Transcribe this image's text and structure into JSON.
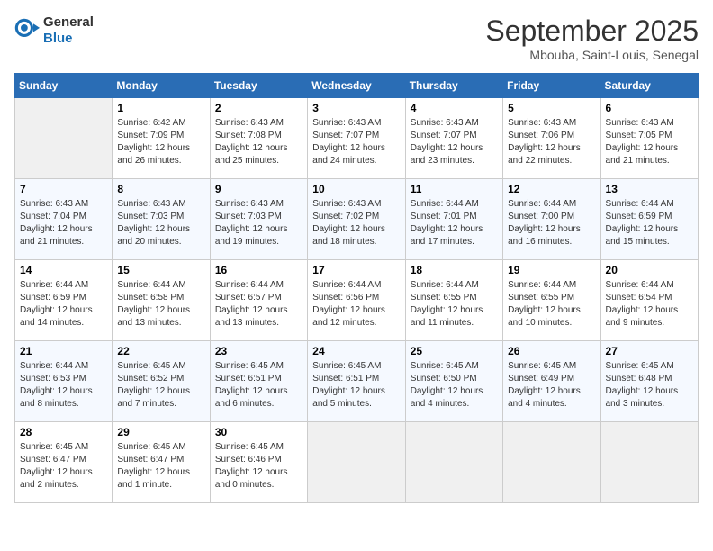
{
  "header": {
    "logo_line1": "General",
    "logo_line2": "Blue",
    "month": "September 2025",
    "location": "Mbouba, Saint-Louis, Senegal"
  },
  "days_of_week": [
    "Sunday",
    "Monday",
    "Tuesday",
    "Wednesday",
    "Thursday",
    "Friday",
    "Saturday"
  ],
  "weeks": [
    [
      {
        "num": "",
        "lines": []
      },
      {
        "num": "1",
        "lines": [
          "Sunrise: 6:42 AM",
          "Sunset: 7:09 PM",
          "Daylight: 12 hours",
          "and 26 minutes."
        ]
      },
      {
        "num": "2",
        "lines": [
          "Sunrise: 6:43 AM",
          "Sunset: 7:08 PM",
          "Daylight: 12 hours",
          "and 25 minutes."
        ]
      },
      {
        "num": "3",
        "lines": [
          "Sunrise: 6:43 AM",
          "Sunset: 7:07 PM",
          "Daylight: 12 hours",
          "and 24 minutes."
        ]
      },
      {
        "num": "4",
        "lines": [
          "Sunrise: 6:43 AM",
          "Sunset: 7:07 PM",
          "Daylight: 12 hours",
          "and 23 minutes."
        ]
      },
      {
        "num": "5",
        "lines": [
          "Sunrise: 6:43 AM",
          "Sunset: 7:06 PM",
          "Daylight: 12 hours",
          "and 22 minutes."
        ]
      },
      {
        "num": "6",
        "lines": [
          "Sunrise: 6:43 AM",
          "Sunset: 7:05 PM",
          "Daylight: 12 hours",
          "and 21 minutes."
        ]
      }
    ],
    [
      {
        "num": "7",
        "lines": [
          "Sunrise: 6:43 AM",
          "Sunset: 7:04 PM",
          "Daylight: 12 hours",
          "and 21 minutes."
        ]
      },
      {
        "num": "8",
        "lines": [
          "Sunrise: 6:43 AM",
          "Sunset: 7:03 PM",
          "Daylight: 12 hours",
          "and 20 minutes."
        ]
      },
      {
        "num": "9",
        "lines": [
          "Sunrise: 6:43 AM",
          "Sunset: 7:03 PM",
          "Daylight: 12 hours",
          "and 19 minutes."
        ]
      },
      {
        "num": "10",
        "lines": [
          "Sunrise: 6:43 AM",
          "Sunset: 7:02 PM",
          "Daylight: 12 hours",
          "and 18 minutes."
        ]
      },
      {
        "num": "11",
        "lines": [
          "Sunrise: 6:44 AM",
          "Sunset: 7:01 PM",
          "Daylight: 12 hours",
          "and 17 minutes."
        ]
      },
      {
        "num": "12",
        "lines": [
          "Sunrise: 6:44 AM",
          "Sunset: 7:00 PM",
          "Daylight: 12 hours",
          "and 16 minutes."
        ]
      },
      {
        "num": "13",
        "lines": [
          "Sunrise: 6:44 AM",
          "Sunset: 6:59 PM",
          "Daylight: 12 hours",
          "and 15 minutes."
        ]
      }
    ],
    [
      {
        "num": "14",
        "lines": [
          "Sunrise: 6:44 AM",
          "Sunset: 6:59 PM",
          "Daylight: 12 hours",
          "and 14 minutes."
        ]
      },
      {
        "num": "15",
        "lines": [
          "Sunrise: 6:44 AM",
          "Sunset: 6:58 PM",
          "Daylight: 12 hours",
          "and 13 minutes."
        ]
      },
      {
        "num": "16",
        "lines": [
          "Sunrise: 6:44 AM",
          "Sunset: 6:57 PM",
          "Daylight: 12 hours",
          "and 13 minutes."
        ]
      },
      {
        "num": "17",
        "lines": [
          "Sunrise: 6:44 AM",
          "Sunset: 6:56 PM",
          "Daylight: 12 hours",
          "and 12 minutes."
        ]
      },
      {
        "num": "18",
        "lines": [
          "Sunrise: 6:44 AM",
          "Sunset: 6:55 PM",
          "Daylight: 12 hours",
          "and 11 minutes."
        ]
      },
      {
        "num": "19",
        "lines": [
          "Sunrise: 6:44 AM",
          "Sunset: 6:55 PM",
          "Daylight: 12 hours",
          "and 10 minutes."
        ]
      },
      {
        "num": "20",
        "lines": [
          "Sunrise: 6:44 AM",
          "Sunset: 6:54 PM",
          "Daylight: 12 hours",
          "and 9 minutes."
        ]
      }
    ],
    [
      {
        "num": "21",
        "lines": [
          "Sunrise: 6:44 AM",
          "Sunset: 6:53 PM",
          "Daylight: 12 hours",
          "and 8 minutes."
        ]
      },
      {
        "num": "22",
        "lines": [
          "Sunrise: 6:45 AM",
          "Sunset: 6:52 PM",
          "Daylight: 12 hours",
          "and 7 minutes."
        ]
      },
      {
        "num": "23",
        "lines": [
          "Sunrise: 6:45 AM",
          "Sunset: 6:51 PM",
          "Daylight: 12 hours",
          "and 6 minutes."
        ]
      },
      {
        "num": "24",
        "lines": [
          "Sunrise: 6:45 AM",
          "Sunset: 6:51 PM",
          "Daylight: 12 hours",
          "and 5 minutes."
        ]
      },
      {
        "num": "25",
        "lines": [
          "Sunrise: 6:45 AM",
          "Sunset: 6:50 PM",
          "Daylight: 12 hours",
          "and 4 minutes."
        ]
      },
      {
        "num": "26",
        "lines": [
          "Sunrise: 6:45 AM",
          "Sunset: 6:49 PM",
          "Daylight: 12 hours",
          "and 4 minutes."
        ]
      },
      {
        "num": "27",
        "lines": [
          "Sunrise: 6:45 AM",
          "Sunset: 6:48 PM",
          "Daylight: 12 hours",
          "and 3 minutes."
        ]
      }
    ],
    [
      {
        "num": "28",
        "lines": [
          "Sunrise: 6:45 AM",
          "Sunset: 6:47 PM",
          "Daylight: 12 hours",
          "and 2 minutes."
        ]
      },
      {
        "num": "29",
        "lines": [
          "Sunrise: 6:45 AM",
          "Sunset: 6:47 PM",
          "Daylight: 12 hours",
          "and 1 minute."
        ]
      },
      {
        "num": "30",
        "lines": [
          "Sunrise: 6:45 AM",
          "Sunset: 6:46 PM",
          "Daylight: 12 hours",
          "and 0 minutes."
        ]
      },
      {
        "num": "",
        "lines": []
      },
      {
        "num": "",
        "lines": []
      },
      {
        "num": "",
        "lines": []
      },
      {
        "num": "",
        "lines": []
      }
    ]
  ]
}
